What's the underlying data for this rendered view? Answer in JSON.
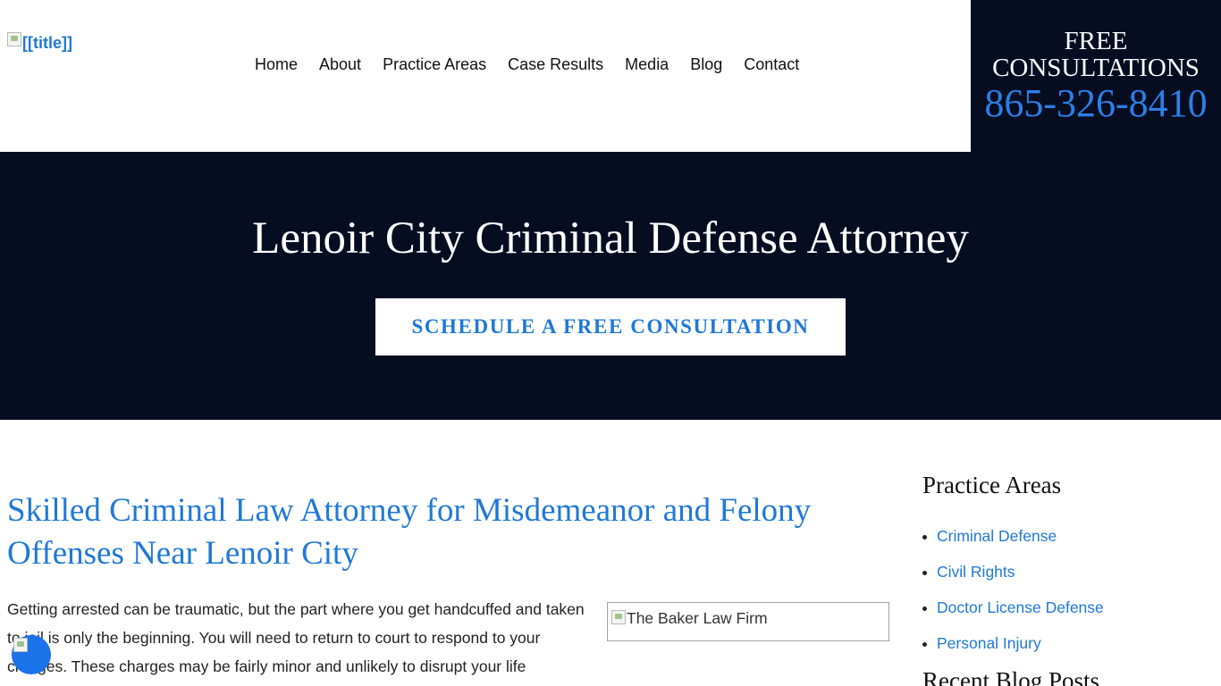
{
  "header": {
    "logo_alt": "[[title]]",
    "nav": [
      "Home",
      "About",
      "Practice Areas",
      "Case Results",
      "Media",
      "Blog",
      "Contact"
    ],
    "cta": {
      "line1": "FREE",
      "line2": "CONSULTATIONS",
      "phone": "865-326-8410"
    }
  },
  "hero": {
    "title": "Lenoir City Criminal Defense Attorney",
    "button": "SCHEDULE A FREE CONSULTATION"
  },
  "main": {
    "heading": "Skilled Criminal Law Attorney for Misdemeanor and Felony Offenses Near Lenoir City",
    "paragraph": "Getting arrested can be traumatic, but the part where you get handcuffed and taken to jail is only the beginning. You will need to return to court to respond to your charges. These charges may be fairly minor and unlikely to disrupt your life",
    "image_alt": "The Baker Law Firm"
  },
  "sidebar": {
    "practice_heading": "Practice Areas",
    "practice_items": [
      "Criminal Defense",
      "Civil Rights",
      "Doctor License Defense",
      "Personal Injury"
    ],
    "recent_heading": "Recent Blog Posts"
  },
  "colors": {
    "navy": "#070d21",
    "link_blue": "#1f78d6",
    "phone_blue": "#2b7fe6",
    "widget_blue": "#1a73e8"
  },
  "icons": {
    "logo": "broken-image-icon",
    "widget": "chat-widget-icon"
  }
}
